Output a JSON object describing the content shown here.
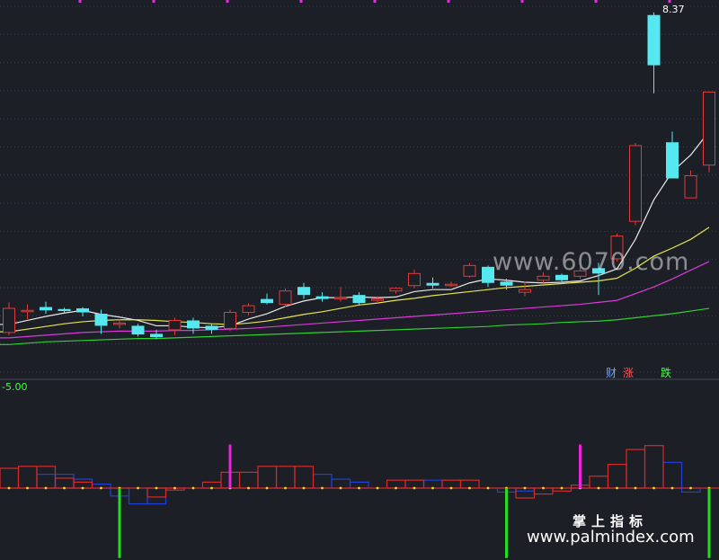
{
  "chart_data": [
    {
      "type": "candlestick",
      "title": "",
      "ylim": [
        3.35,
        8.45
      ],
      "candles": [
        {
          "o": 3.62,
          "h": 4.07,
          "l": 3.58,
          "c": 3.98
        },
        {
          "o": 3.95,
          "h": 4.04,
          "l": 3.82,
          "c": 3.95
        },
        {
          "o": 4.0,
          "h": 4.08,
          "l": 3.9,
          "c": 3.95
        },
        {
          "o": 3.97,
          "h": 3.99,
          "l": 3.92,
          "c": 3.94
        },
        {
          "o": 3.98,
          "h": 4.0,
          "l": 3.86,
          "c": 3.92
        },
        {
          "o": 3.9,
          "h": 3.96,
          "l": 3.6,
          "c": 3.72
        },
        {
          "o": 3.74,
          "h": 3.82,
          "l": 3.68,
          "c": 3.76
        },
        {
          "o": 3.72,
          "h": 3.75,
          "l": 3.56,
          "c": 3.59
        },
        {
          "o": 3.6,
          "h": 3.66,
          "l": 3.52,
          "c": 3.55
        },
        {
          "o": 3.66,
          "h": 3.84,
          "l": 3.58,
          "c": 3.8
        },
        {
          "o": 3.8,
          "h": 3.84,
          "l": 3.6,
          "c": 3.68
        },
        {
          "o": 3.72,
          "h": 3.76,
          "l": 3.6,
          "c": 3.66
        },
        {
          "o": 3.68,
          "h": 3.96,
          "l": 3.64,
          "c": 3.92
        },
        {
          "o": 3.92,
          "h": 4.06,
          "l": 3.88,
          "c": 4.02
        },
        {
          "o": 4.12,
          "h": 4.2,
          "l": 4.04,
          "c": 4.06
        },
        {
          "o": 4.04,
          "h": 4.28,
          "l": 4.0,
          "c": 4.24
        },
        {
          "o": 4.3,
          "h": 4.36,
          "l": 4.12,
          "c": 4.18
        },
        {
          "o": 4.16,
          "h": 4.22,
          "l": 4.08,
          "c": 4.12
        },
        {
          "o": 4.12,
          "h": 4.3,
          "l": 4.08,
          "c": 4.14
        },
        {
          "o": 4.18,
          "h": 4.22,
          "l": 4.02,
          "c": 4.06
        },
        {
          "o": 4.1,
          "h": 4.16,
          "l": 4.06,
          "c": 4.12
        },
        {
          "o": 4.24,
          "h": 4.3,
          "l": 4.2,
          "c": 4.28
        },
        {
          "o": 4.32,
          "h": 4.56,
          "l": 4.28,
          "c": 4.5
        },
        {
          "o": 4.36,
          "h": 4.44,
          "l": 4.28,
          "c": 4.32
        },
        {
          "o": 4.32,
          "h": 4.38,
          "l": 4.3,
          "c": 4.34
        },
        {
          "o": 4.46,
          "h": 4.66,
          "l": 4.44,
          "c": 4.62
        },
        {
          "o": 4.6,
          "h": 4.62,
          "l": 4.3,
          "c": 4.36
        },
        {
          "o": 4.38,
          "h": 4.42,
          "l": 4.26,
          "c": 4.32
        },
        {
          "o": 4.22,
          "h": 4.38,
          "l": 4.16,
          "c": 4.26
        },
        {
          "o": 4.4,
          "h": 4.52,
          "l": 4.36,
          "c": 4.46
        },
        {
          "o": 4.48,
          "h": 4.5,
          "l": 4.36,
          "c": 4.4
        },
        {
          "o": 4.46,
          "h": 4.6,
          "l": 4.42,
          "c": 4.54
        },
        {
          "o": 4.58,
          "h": 4.66,
          "l": 4.18,
          "c": 4.5
        },
        {
          "o": 4.72,
          "h": 5.1,
          "l": 4.68,
          "c": 5.06
        },
        {
          "o": 5.28,
          "h": 6.45,
          "l": 5.22,
          "c": 6.41
        },
        {
          "o": 8.36,
          "h": 8.4,
          "l": 7.19,
          "c": 7.61
        },
        {
          "o": 6.46,
          "h": 6.62,
          "l": 5.92,
          "c": 5.92
        },
        {
          "o": 5.63,
          "h": 6.04,
          "l": 5.63,
          "c": 5.96
        },
        {
          "o": 6.12,
          "h": 7.21,
          "l": 6.01,
          "c": 7.21
        }
      ],
      "series": [
        {
          "values": [
            3.74,
            3.8,
            3.86,
            3.91,
            3.95,
            3.89,
            3.85,
            3.8,
            3.72,
            3.72,
            3.7,
            3.69,
            3.72,
            3.82,
            3.9,
            4.01,
            4.09,
            4.14,
            4.14,
            4.15,
            4.14,
            4.15,
            4.23,
            4.26,
            4.26,
            4.36,
            4.42,
            4.4,
            4.37,
            4.36,
            4.37,
            4.39,
            4.47,
            4.57,
            5.01,
            5.6,
            6.02,
            6.27,
            6.62
          ],
          "color": "#e8e8e8"
        },
        {
          "values": [
            3.63,
            3.67,
            3.71,
            3.75,
            3.78,
            3.8,
            3.81,
            3.81,
            3.8,
            3.78,
            3.77,
            3.75,
            3.74,
            3.76,
            3.79,
            3.84,
            3.89,
            3.93,
            3.98,
            4.03,
            4.06,
            4.1,
            4.13,
            4.17,
            4.2,
            4.23,
            4.26,
            4.29,
            4.31,
            4.33,
            4.35,
            4.37,
            4.39,
            4.43,
            4.58,
            4.76,
            4.88,
            5.01,
            5.19
          ],
          "color": "#e5e54a"
        },
        {
          "values": [
            3.54,
            3.56,
            3.58,
            3.6,
            3.62,
            3.63,
            3.64,
            3.64,
            3.64,
            3.65,
            3.65,
            3.66,
            3.67,
            3.68,
            3.7,
            3.72,
            3.74,
            3.76,
            3.78,
            3.8,
            3.82,
            3.84,
            3.86,
            3.88,
            3.9,
            3.92,
            3.94,
            3.96,
            3.98,
            4.0,
            4.02,
            4.04,
            4.07,
            4.1,
            4.2,
            4.3,
            4.42,
            4.55,
            4.68
          ],
          "color": "#d93ad9"
        },
        {
          "values": [
            3.44,
            3.46,
            3.48,
            3.49,
            3.5,
            3.51,
            3.52,
            3.53,
            3.53,
            3.54,
            3.55,
            3.56,
            3.57,
            3.58,
            3.59,
            3.6,
            3.61,
            3.62,
            3.63,
            3.64,
            3.65,
            3.66,
            3.67,
            3.68,
            3.69,
            3.7,
            3.71,
            3.73,
            3.74,
            3.75,
            3.77,
            3.78,
            3.79,
            3.81,
            3.84,
            3.87,
            3.9,
            3.94,
            3.98
          ],
          "color": "#2fd02f"
        }
      ],
      "max_label": "8.37",
      "buttons": [
        "财",
        "涨",
        "跌"
      ]
    },
    {
      "type": "step-histogram",
      "ylim": [
        -5.5,
        5.5
      ],
      "zero_line": 0,
      "value_label": "-5.00",
      "red": [
        2.0,
        2.2,
        2.2,
        1.0,
        0.6,
        0.0,
        0.0,
        0.0,
        -0.9,
        -0.2,
        0.0,
        0.6,
        1.6,
        1.6,
        2.2,
        2.2,
        2.2,
        0.0,
        0.0,
        0.0,
        0.0,
        0.8,
        0.8,
        0.0,
        0.8,
        0.8,
        0.0,
        0.0,
        -1.0,
        -0.6,
        -0.3,
        0.3,
        1.2,
        2.4,
        3.9,
        4.3,
        0.0,
        0.0,
        0.0
      ],
      "blue": [
        0.0,
        0.0,
        1.4,
        1.4,
        0.9,
        0.4,
        -0.8,
        -1.6,
        -1.6,
        0.0,
        0.0,
        0.0,
        0.0,
        0.0,
        0.0,
        0.0,
        0.0,
        1.4,
        0.9,
        0.6,
        0.0,
        0.0,
        0.0,
        0.8,
        0.0,
        0.0,
        0.0,
        -0.4,
        -0.3,
        0.0,
        0.0,
        0.0,
        0.0,
        0.0,
        0.0,
        0.0,
        2.6,
        -0.4,
        0.0
      ],
      "green_spikes": [
        {
          "index": 6,
          "value": -2.7
        },
        {
          "index": 27,
          "value": -2.7
        },
        {
          "index": 38,
          "value": -2.7
        }
      ],
      "magenta_spikes": [
        {
          "index": 12,
          "value": 4.5
        },
        {
          "index": 31,
          "value": 4.5
        }
      ]
    }
  ],
  "watermarks": {
    "main": "www.6070.com",
    "title": "掌上指标",
    "url": "www.palmindex.com"
  },
  "colors": {
    "bg": "#1c1f26",
    "up": "#e03c3c",
    "down": "#55e8f0",
    "grid": "#3a3f4e",
    "histRed": "#d42a2a",
    "histBlue": "#2040d8",
    "spikeGreen": "#22dd22",
    "spikeMagenta": "#ee22dd",
    "zeroDot": "#e0e020",
    "cai": "#6aa8ff",
    "zhang": "#ff5a5a",
    "die": "#4cff4c",
    "indVal": "#40ff40"
  }
}
